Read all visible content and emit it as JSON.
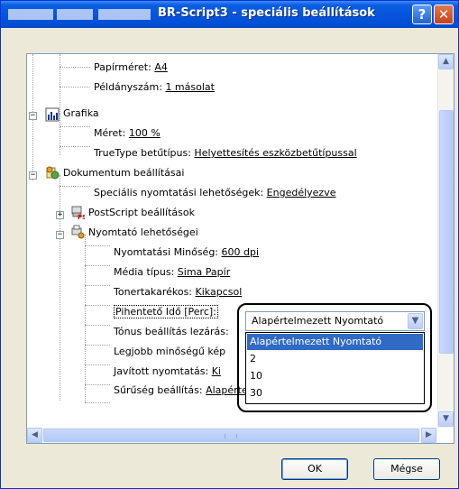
{
  "window": {
    "title": "BR-Script3 - speciális beállítások",
    "help_glyph": "?",
    "close_glyph": "✕"
  },
  "tree": {
    "paper_size_label": "Papírméret:",
    "paper_size_value": "A4",
    "copies_label": "Példányszám:",
    "copies_value": "1 másolat",
    "graphics_label": "Grafika",
    "scale_label": "Méret:",
    "scale_value": "100 %",
    "truetype_label": "TrueType betűtípus:",
    "truetype_value": "Helyettesítés eszközbetűtípussal",
    "doc_options_label": "Dokumentum beállításai",
    "special_print_label": "Speciális nyomtatási lehetőségek:",
    "special_print_value": "Engedélyezve",
    "postscript_label": "PostScript beállítások",
    "printer_features_label": "Nyomtató lehetőségei",
    "print_quality_label": "Nyomtatási Minőség:",
    "print_quality_value": "600 dpi",
    "media_type_label": "Média típus:",
    "media_type_value": "Sima Papír",
    "toner_save_label": "Tonertakarékos:",
    "toner_save_value": "Kikapcsol",
    "sleep_time_label": "Pihentető Idő [Perc]:",
    "tone_lock_label": "Tónus beállítás lezárás:",
    "best_quality_label": "Legjobb minőségű kép",
    "improved_print_label": "Javított nyomtatás:",
    "improved_print_value": "Ki",
    "density_label": "Sűrűség beállítás:",
    "density_value": "Alapértelmezett nyomtató"
  },
  "combo": {
    "value": "Alapértelmezett Nyomtató",
    "options": [
      "Alapértelmezett Nyomtató",
      "2",
      "10",
      "30"
    ],
    "selected_index": 0
  },
  "buttons": {
    "ok": "OK",
    "cancel": "Mégse"
  },
  "colors": {
    "titlebar": "#0655dd",
    "selection": "#316ac5",
    "dialog_bg": "#ece9d8"
  }
}
